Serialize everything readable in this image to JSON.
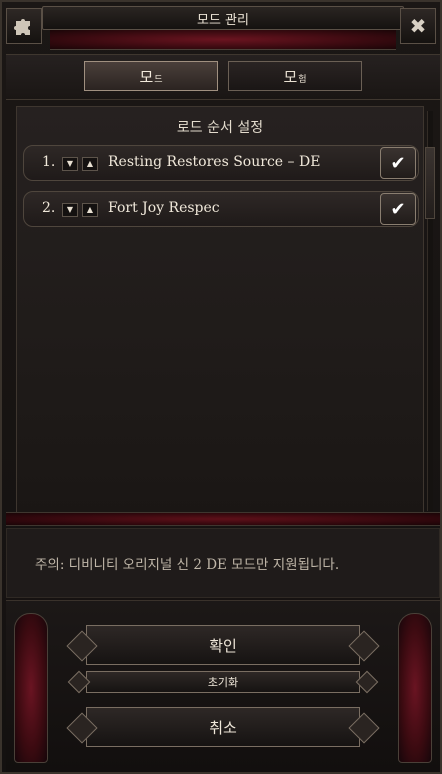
{
  "window": {
    "title": "모드 관리",
    "close_glyph": "✖",
    "left_icon": "puzzle-icon"
  },
  "tabs": [
    {
      "big": "모",
      "small": "드",
      "active": true
    },
    {
      "big": "모",
      "small": "험",
      "active": false
    }
  ],
  "load_order": {
    "title": "로드 순서 설정",
    "mods": [
      {
        "index": "1.",
        "name": "Resting Restores Source – DE",
        "enabled": true
      },
      {
        "index": "2.",
        "name": "Fort Joy Respec",
        "enabled": true
      }
    ]
  },
  "note": "주의: 디비니티 오리지널 신 2 DE 모드만 지원됩니다.",
  "buttons": {
    "confirm": "확인",
    "reset": "초기화",
    "cancel": "취소"
  },
  "glyphs": {
    "check": "✔",
    "arrow_down": "▼",
    "arrow_up": "▲"
  },
  "colors": {
    "crimson": "#6b1420",
    "frame": "#1b1715",
    "text": "#e8e0d2"
  }
}
